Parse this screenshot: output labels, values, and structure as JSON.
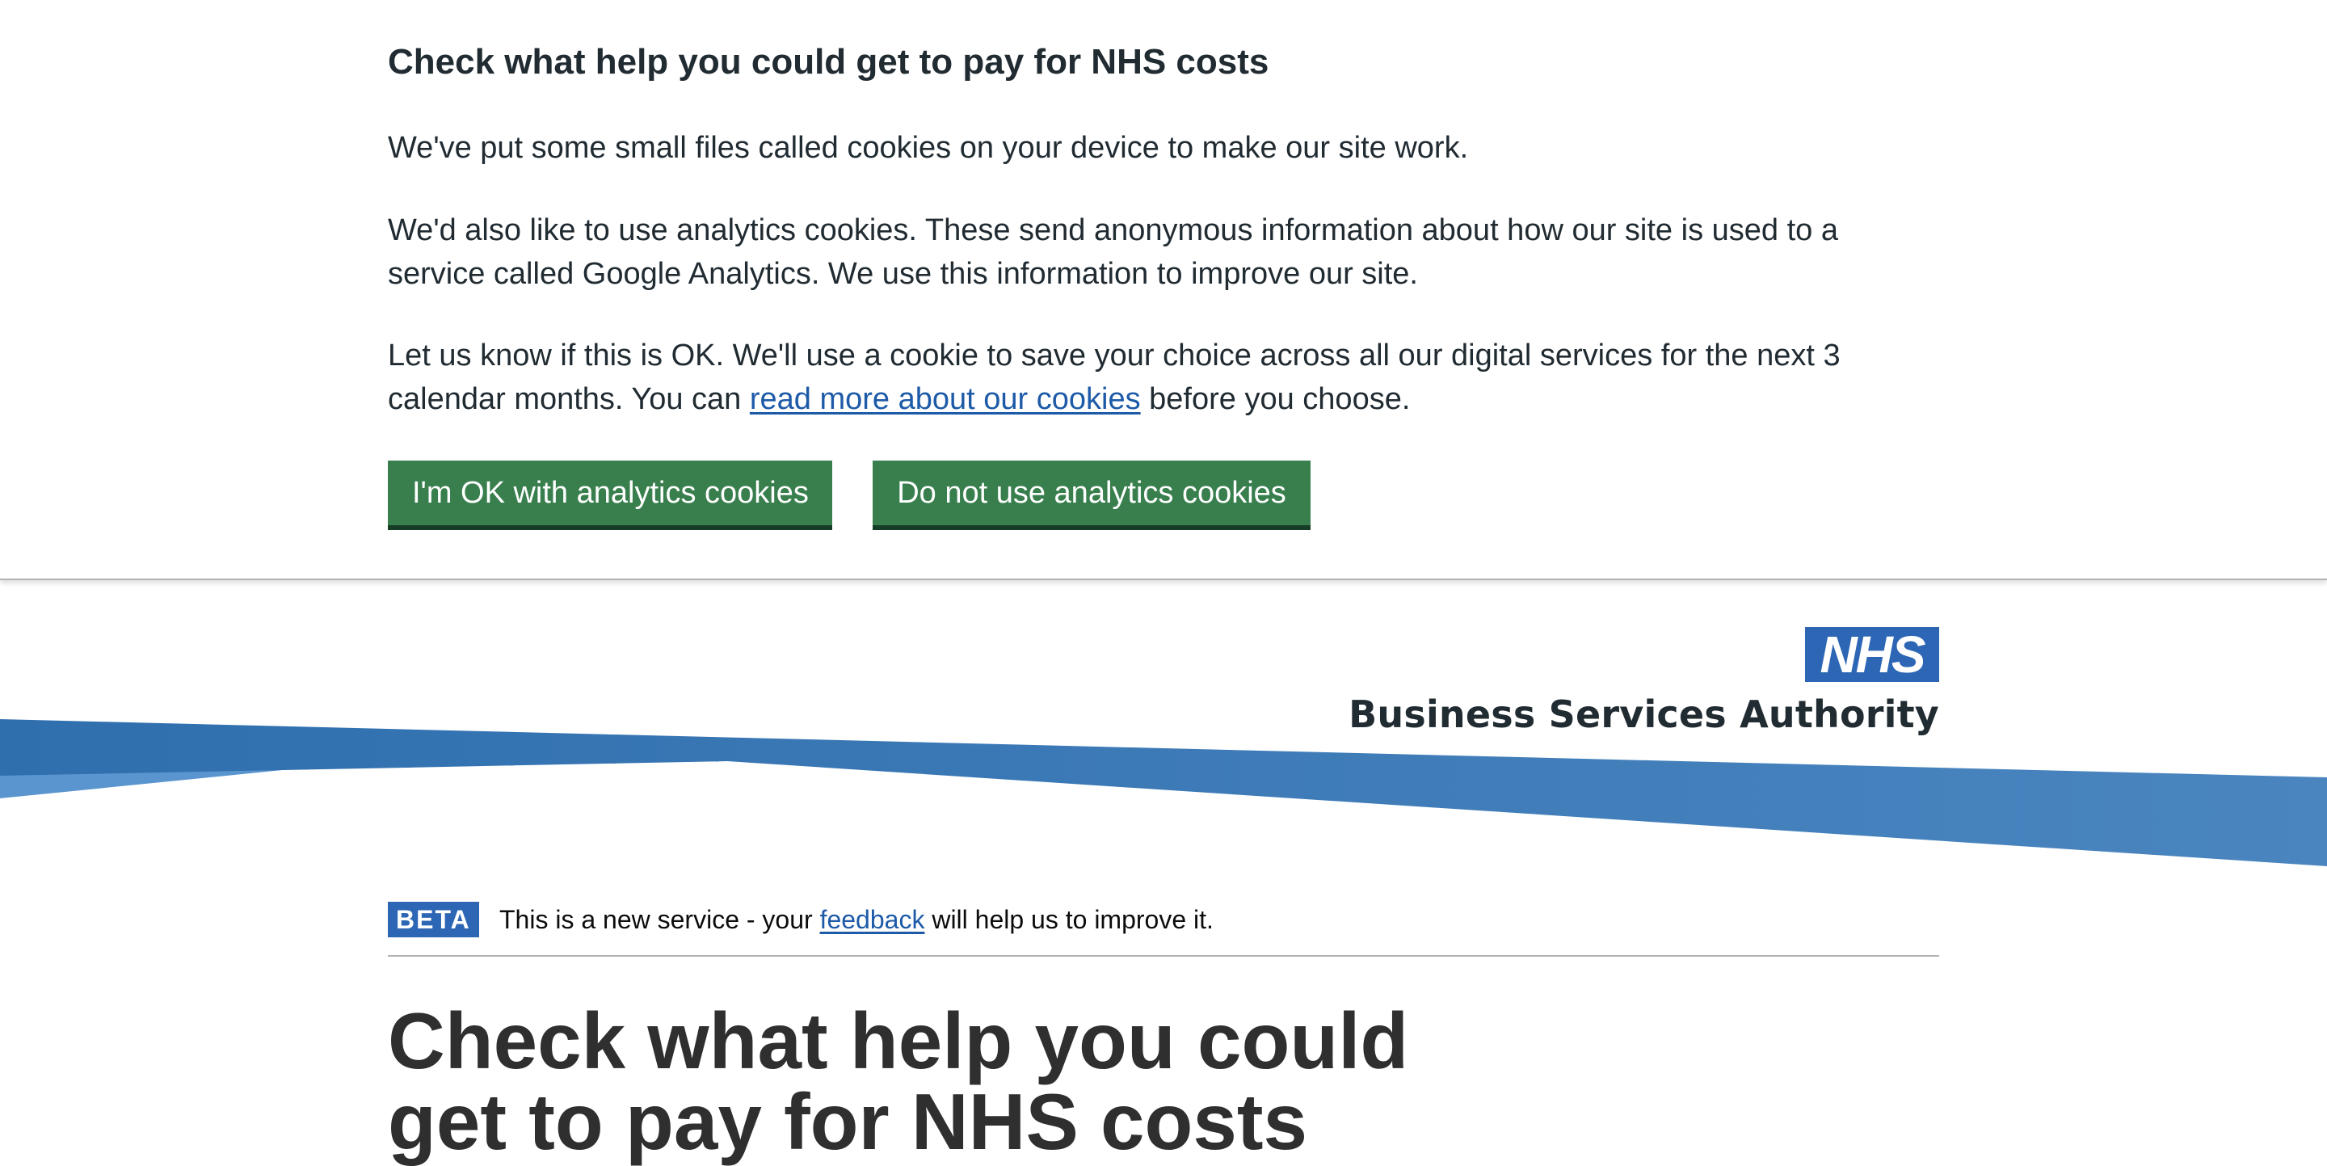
{
  "cookie_banner": {
    "title": "Check what help you could get to pay for NHS costs",
    "paragraph_1": "We've put some small files called cookies on your device to make our site work.",
    "paragraph_2": "We'd also like to use analytics cookies. These send anonymous information about how our site is used to a service called Google Analytics. We use this information to improve our site.",
    "paragraph_3_before": "Let us know if this is OK. We'll use a cookie to save your choice across all our digital services for the next 3 calendar months. You can ",
    "paragraph_3_link": "read more about our cookies",
    "paragraph_3_after": " before you choose.",
    "accept_label": "I'm OK with analytics cookies",
    "reject_label": "Do not use analytics cookies"
  },
  "header": {
    "logo_text": "NHS",
    "org_name": "Business Services Authority"
  },
  "phase_banner": {
    "tag": "BETA",
    "text_before": "This is a new service - your ",
    "link": "feedback",
    "text_after": " will help us to improve it."
  },
  "main": {
    "title": "Check what help you could get to pay for NHS costs"
  },
  "colors": {
    "brand_blue": "#2c66b4",
    "button_green": "#387f4d",
    "link_blue": "#1d5aa7",
    "text": "#212b32"
  }
}
